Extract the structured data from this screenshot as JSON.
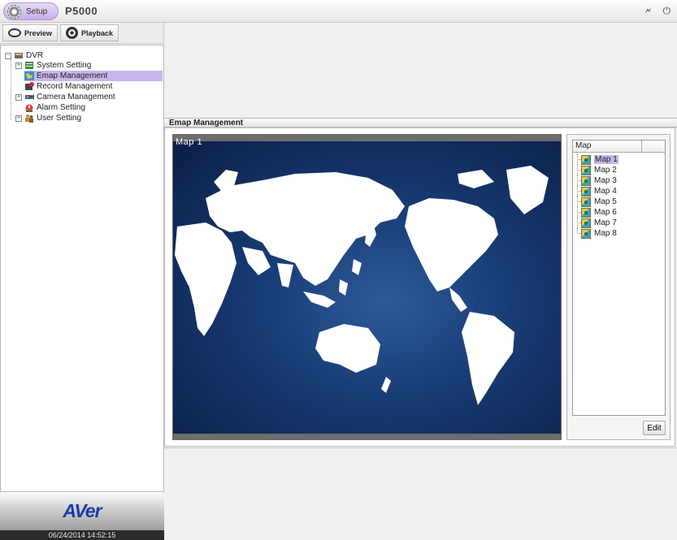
{
  "topbar": {
    "setup_label": "Setup",
    "model": "P5000",
    "icons": [
      "usb-icon",
      "power-icon"
    ]
  },
  "tabs": [
    {
      "label": "Preview",
      "icon": "eye-icon"
    },
    {
      "label": "Playback",
      "icon": "film-reel-icon"
    }
  ],
  "tree": {
    "root": "DVR",
    "items": [
      {
        "label": "System Setting",
        "expandable": true
      },
      {
        "label": "Emap Management",
        "expandable": false,
        "selected": true
      },
      {
        "label": "Record Management",
        "expandable": false
      },
      {
        "label": "Camera Management",
        "expandable": true
      },
      {
        "label": "Alarm Setting",
        "expandable": false
      },
      {
        "label": "User Setting",
        "expandable": true
      }
    ]
  },
  "brand": {
    "logo": "AVer",
    "datetime": "06/24/2014 14:52:15"
  },
  "section": {
    "title": "Emap Management"
  },
  "map_view": {
    "label": "Map 1"
  },
  "map_list": {
    "header": "Map",
    "items": [
      "Map 1",
      "Map 2",
      "Map 3",
      "Map 4",
      "Map 5",
      "Map 6",
      "Map 7",
      "Map 8"
    ],
    "selected": "Map 1",
    "edit_label": "Edit"
  },
  "colors": {
    "accent": "#c8b6ea",
    "map_ocean": "#173a72",
    "logo": "#1c3aa6"
  }
}
